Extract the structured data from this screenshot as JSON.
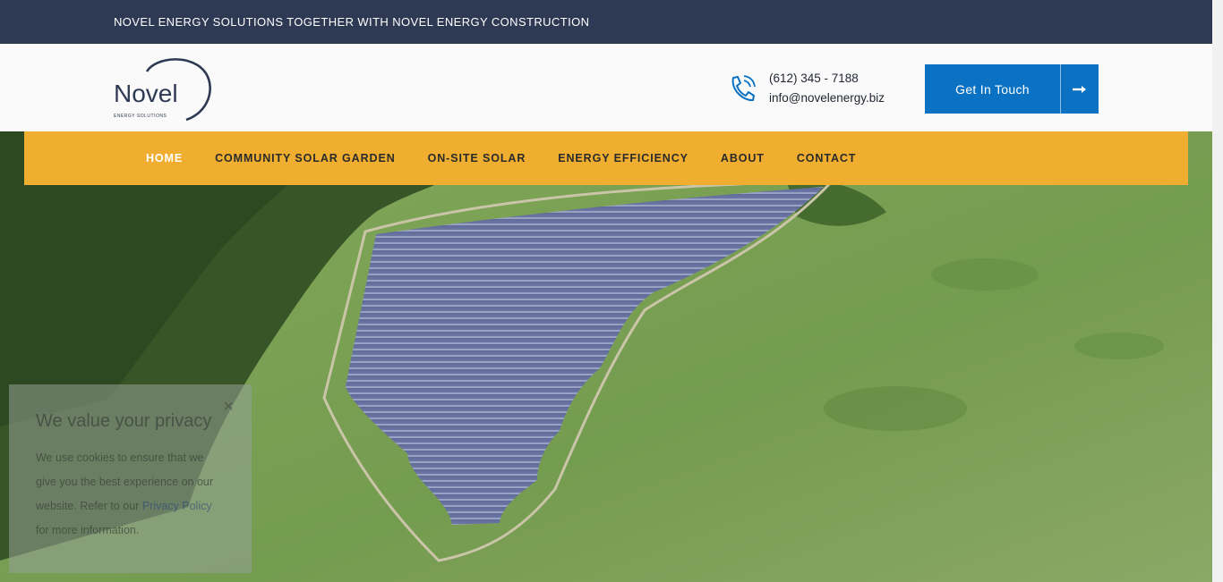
{
  "banner": {
    "text": "NOVEL ENERGY SOLUTIONS TOGETHER WITH NOVEL ENERGY CONSTRUCTION"
  },
  "logo": {
    "wordmark": "Novel",
    "tagline": "ENERGY SOLUTIONS"
  },
  "contact": {
    "phone": "(612) 345 - 7188",
    "email": "info@novelenergy.biz"
  },
  "cta": {
    "label": "Get In Touch"
  },
  "nav": {
    "items": [
      {
        "label": "HOME"
      },
      {
        "label": "COMMUNITY SOLAR GARDEN"
      },
      {
        "label": "ON-SITE SOLAR"
      },
      {
        "label": "ENERGY EFFICIENCY"
      },
      {
        "label": "ABOUT"
      },
      {
        "label": "CONTACT"
      }
    ],
    "active_index": 0
  },
  "cookie": {
    "title": "We value your privacy",
    "text_before_link": "We use cookies to ensure that we give you the best experience on our website. Refer to our ",
    "link": "Privacy Policy",
    "text_after_link": " for more information.",
    "close": "×"
  },
  "colors": {
    "banner": "#2e3953",
    "nav": "#efae2f",
    "cta": "#0b72c3",
    "logo": "#2e3953"
  },
  "icons": {
    "phone": "phone-icon",
    "arrow": "arrow-right-icon",
    "close": "close-icon"
  }
}
